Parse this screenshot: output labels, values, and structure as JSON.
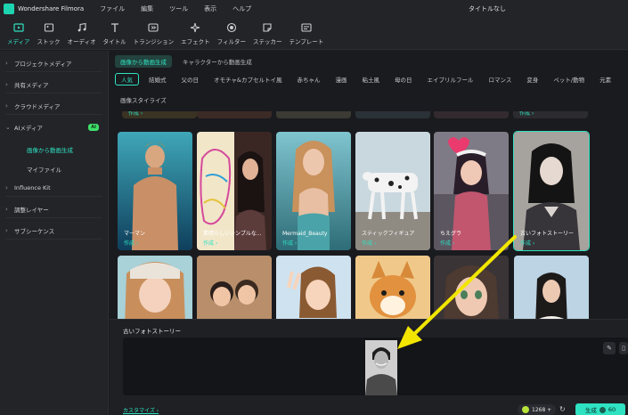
{
  "app": {
    "name": "Wondershare Filmora",
    "document_title": "タイトルなし",
    "menu": [
      "ファイル",
      "編集",
      "ツール",
      "表示",
      "ヘルプ"
    ]
  },
  "toolbar": [
    {
      "label": "メディア",
      "icon": "media-icon",
      "active": true
    },
    {
      "label": "ストック",
      "icon": "stock-icon",
      "active": false
    },
    {
      "label": "オーディオ",
      "icon": "music-note-icon",
      "active": false
    },
    {
      "label": "タイトル",
      "icon": "title-t-icon",
      "active": false
    },
    {
      "label": "トランジション",
      "icon": "transition-icon",
      "active": false
    },
    {
      "label": "エフェクト",
      "icon": "effect-icon",
      "active": false
    },
    {
      "label": "フィルター",
      "icon": "filter-icon",
      "active": false
    },
    {
      "label": "ステッカー",
      "icon": "sticker-icon",
      "active": false
    },
    {
      "label": "テンプレート",
      "icon": "template-icon",
      "active": false
    }
  ],
  "sidebar": {
    "items": [
      {
        "label": "プロジェクトメディア"
      },
      {
        "label": "共有メディア"
      },
      {
        "label": "クラウドメディア"
      },
      {
        "label": "AIメディア",
        "badge": "AI",
        "open": true
      }
    ],
    "ai_sub": [
      {
        "label": "画像から動画生成",
        "active": true
      },
      {
        "label": "マイファイル",
        "active": false
      }
    ],
    "items_after": [
      {
        "label": "Influence Kit"
      },
      {
        "label": "調整レイヤー"
      },
      {
        "label": "サブシーケンス"
      }
    ]
  },
  "main": {
    "subtabs": [
      {
        "label": "画像から動画生成",
        "active": true
      },
      {
        "label": "キャラクターから動画生成",
        "active": false
      }
    ],
    "categories": [
      {
        "label": "人気",
        "active": true
      },
      {
        "label": "結婚式"
      },
      {
        "label": "父の日"
      },
      {
        "label": "オモチャ&カプセルトイ風"
      },
      {
        "label": "赤ちゃん"
      },
      {
        "label": "漫画"
      },
      {
        "label": "粘土風"
      },
      {
        "label": "母の日"
      },
      {
        "label": "エイプリルフール"
      },
      {
        "label": "ロマンス"
      },
      {
        "label": "変身"
      },
      {
        "label": "ペット/動物"
      },
      {
        "label": "元素"
      },
      {
        "label": "画像スタイライズ"
      }
    ],
    "make_label": "作成 ›",
    "cards": [
      {
        "label": "マーマン"
      },
      {
        "label": "素晴らしいシンプルな..."
      },
      {
        "label": "Mermaid_Beauty"
      },
      {
        "label": "スティックフィギュア"
      },
      {
        "label": "ちえグラ"
      },
      {
        "label": "古いフォトストーリー",
        "selected": true
      }
    ]
  },
  "panel": {
    "title": "古いフォトストーリー",
    "customize": "カスタマイズ ›",
    "credits": "1268 +",
    "generate": "生成",
    "generate_cost": "60"
  },
  "colors": {
    "accent": "#2ee2c2",
    "arrow": "#f2e600",
    "background": "#1a1b1f"
  }
}
